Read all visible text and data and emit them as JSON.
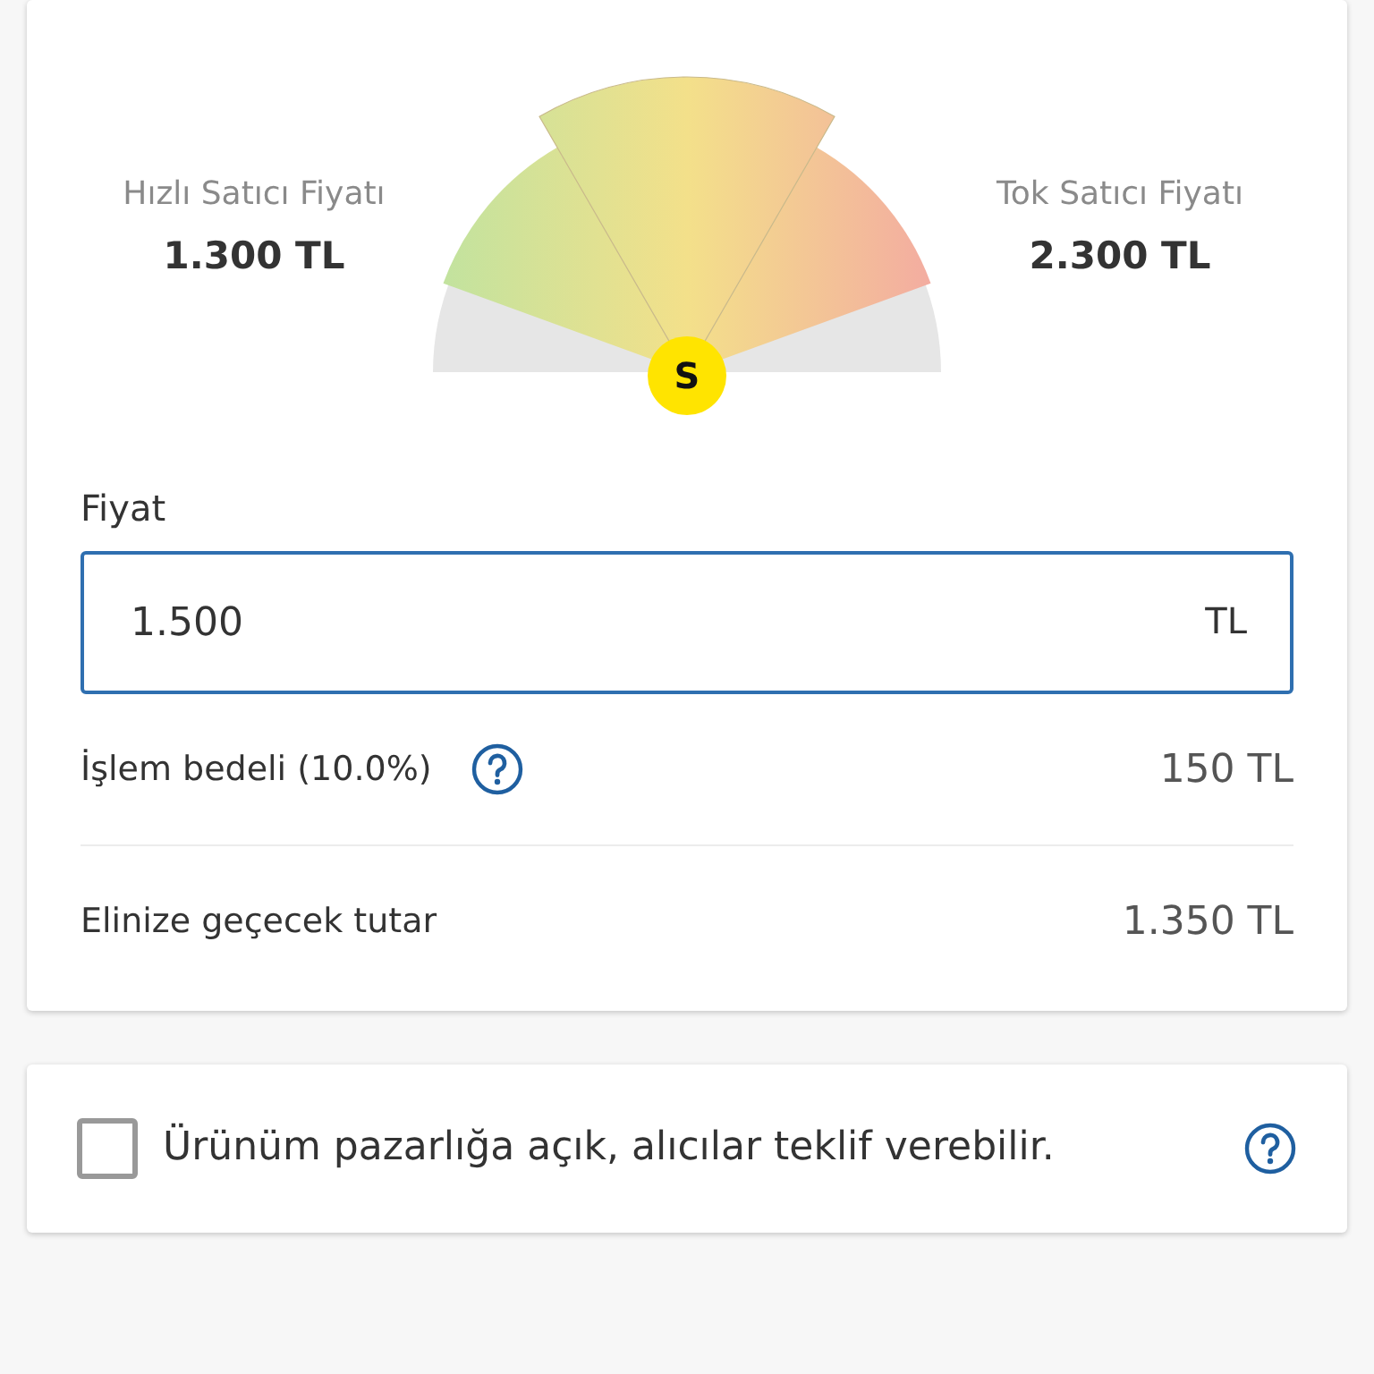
{
  "gauge": {
    "left": {
      "label": "Hızlı Satıcı Fiyatı",
      "value": "1.300 TL"
    },
    "right": {
      "label": "Tok Satıcı Fiyatı",
      "value": "2.300 TL"
    },
    "marker": "S"
  },
  "price": {
    "label": "Fiyat",
    "value": "1.500",
    "unit": "TL"
  },
  "rows": [
    {
      "label": "İşlem bedeli (10.0%)",
      "value": "150 TL",
      "help": true
    },
    {
      "label": "Elinize geçecek tutar",
      "value": "1.350 TL",
      "help": false
    }
  ],
  "negotiable": {
    "label": "Ürünüm pazarlığa açık, alıcılar teklif verebilir.",
    "checked": false
  }
}
